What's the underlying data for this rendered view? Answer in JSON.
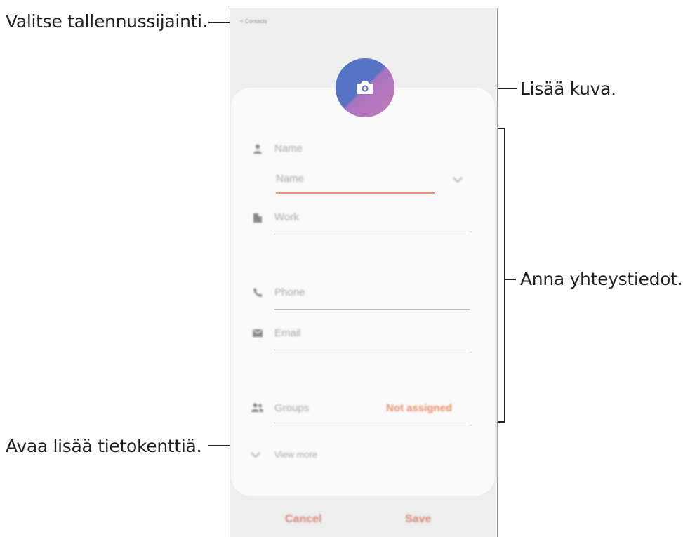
{
  "callouts": {
    "storage": "Valitse tallennussijainti.",
    "photo": "Lisää kuva.",
    "info": "Anna yhteystiedot.",
    "more": "Avaa lisää tietokenttiä."
  },
  "screen": {
    "storage_location": "< Contacts",
    "fields": {
      "name_label": "Name",
      "name_input_placeholder": "Name",
      "work_label": "Work",
      "phone_label": "Phone",
      "email_label": "Email",
      "groups_label": "Groups",
      "groups_value": "Not assigned"
    },
    "view_more": "View more",
    "buttons": {
      "cancel": "Cancel",
      "save": "Save"
    }
  },
  "colors": {
    "accent": "#e8916b",
    "button_text": "#d98a73",
    "background": "#efeeef",
    "card": "#fafafa"
  }
}
